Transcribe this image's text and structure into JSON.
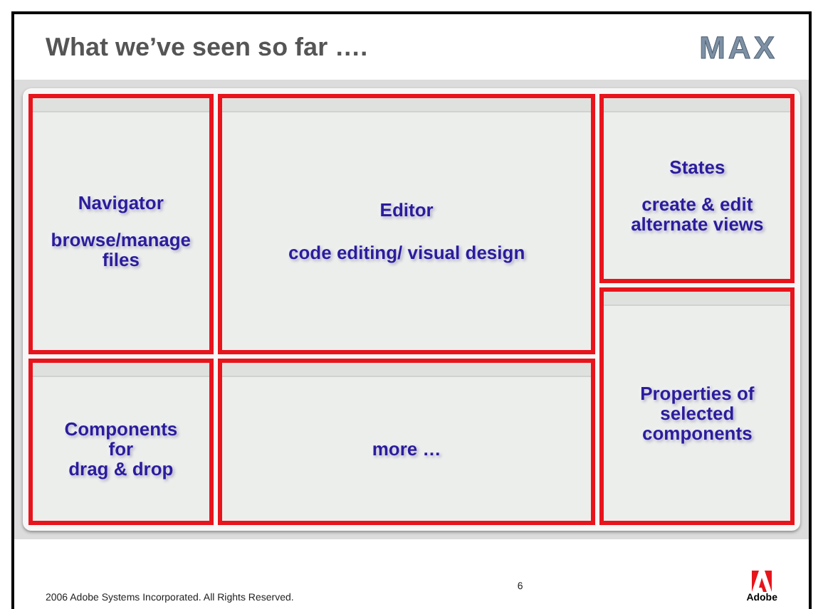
{
  "slide": {
    "title": "What we’ve seen so far ….",
    "logo": "MAX"
  },
  "regions": [
    {
      "kind": "navigator",
      "lines": [
        "Navigator",
        "browse/manage files"
      ]
    },
    {
      "kind": "components",
      "lines": [
        "Components",
        "for",
        "drag & drop"
      ]
    },
    {
      "kind": "editor",
      "lines": [
        "Editor",
        "code editing/ visual design"
      ]
    },
    {
      "kind": "more",
      "lines": [
        "more …"
      ]
    },
    {
      "kind": "states",
      "lines": [
        "States",
        "create & edit alternate views"
      ]
    },
    {
      "kind": "properties",
      "lines": [
        "Properties of selected components"
      ]
    }
  ],
  "footer": {
    "copyright": "2006 Adobe Systems Incorporated.  All Rights Reserved.",
    "page": "6",
    "brand": "Adobe"
  }
}
